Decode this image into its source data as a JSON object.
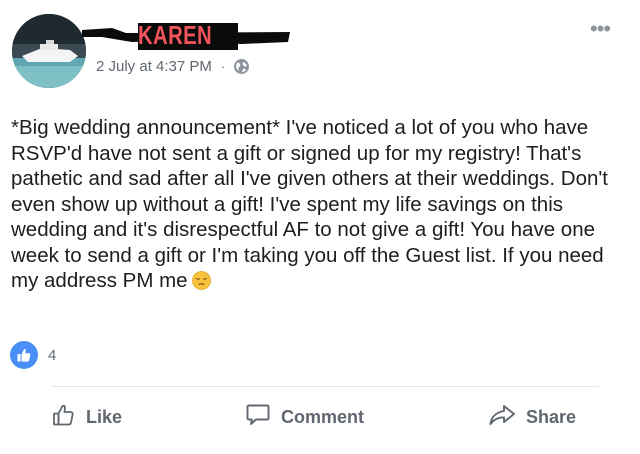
{
  "post": {
    "author": "KAREN",
    "timestamp": "2 July at 4:37 PM",
    "separator": "·",
    "privacy_icon": "globe-icon",
    "more_label": "•••",
    "text": "*Big wedding announcement* I've noticed a lot of you who have RSVP'd have not sent a gift or signed up for my registry! That's pathetic and sad after all I've given others at their weddings. Don't even show up without a gift! I've spent my life savings on this wedding and it's disrespectful AF to not give a gift! You have one week to send a gift or I'm taking you off the Guest list. If you need my address PM me",
    "emoji": "pensive-face-icon"
  },
  "reactions": {
    "icon": "thumbs-up-icon",
    "count": "4"
  },
  "actions": {
    "like": "Like",
    "comment": "Comment",
    "share": "Share"
  },
  "colors": {
    "name": "#f2545b",
    "redaction": "#0b0b0b",
    "reaction_blue": "#4a8ff7",
    "muted": "#616770",
    "divider": "#e5e6e9"
  }
}
